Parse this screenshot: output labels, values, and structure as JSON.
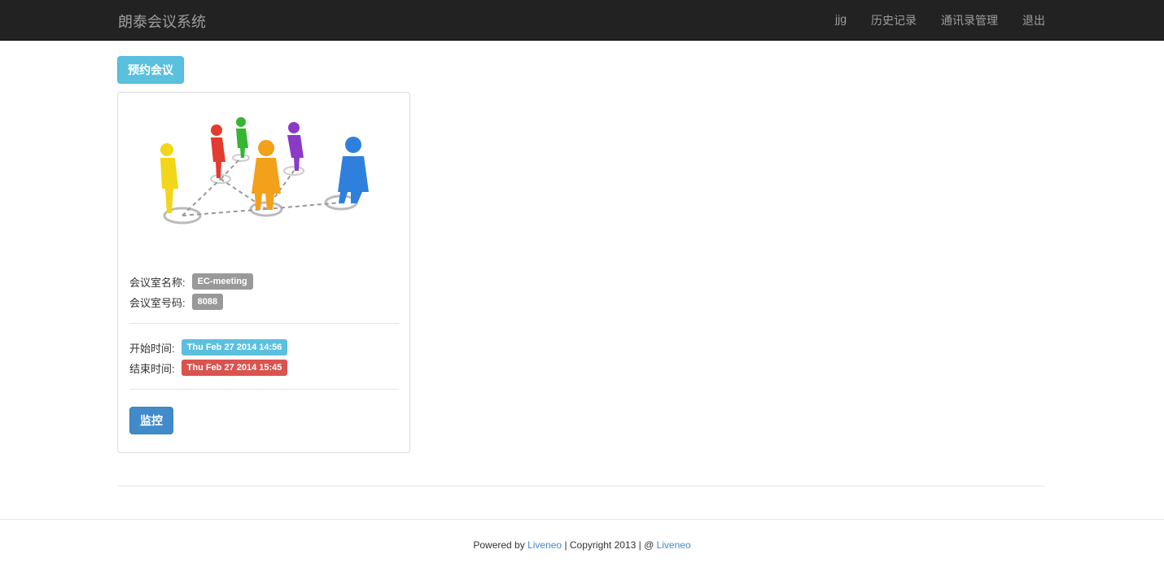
{
  "navbar": {
    "brand": "朗泰会议系统",
    "links": [
      "jjg",
      "历史记录",
      "通讯录管理",
      "退出"
    ]
  },
  "actions": {
    "book_label": "预约会议"
  },
  "meeting": {
    "image_icon": "people-network-illustration",
    "room_name_label": "会议室名称:",
    "room_name": "EC-meeting",
    "room_number_label": "会议室号码:",
    "room_number": "8088",
    "start_label": "开始时间:",
    "start_time": "Thu Feb 27 2014 14:56",
    "end_label": "结束时间:",
    "end_time": "Thu Feb 27 2014 15:45",
    "monitor_label": "监控"
  },
  "footer": {
    "powered_by": "Powered by ",
    "link1": "Liveneo",
    "copyright": " | Copyright 2013 | @ ",
    "link2": "Liveneo"
  },
  "colors": {
    "navbar_bg": "#222222",
    "info": "#5bc0de",
    "primary": "#428bca",
    "danger": "#d9534f",
    "default": "#999999"
  }
}
